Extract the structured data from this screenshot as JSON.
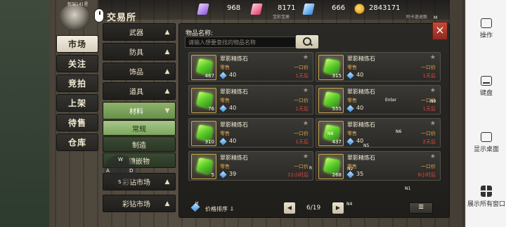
{
  "header": {
    "title": "交易所",
    "level_text": "新瑞141星",
    "close_label": "×"
  },
  "currencies": [
    {
      "icon": "purple-gem-icon",
      "value": "968",
      "color": "#b58af0"
    },
    {
      "icon": "red-gem-icon",
      "value": "8171",
      "color": "#ff5c8a"
    },
    {
      "icon": "blue-gem-icon",
      "value": "666",
      "color": "#5ab4ff"
    },
    {
      "icon": "gold-coin-icon",
      "value": "2843171",
      "color": "#f0b63a"
    }
  ],
  "topbar_sub": {
    "left": "宝前宝册",
    "right": "阿卡迷途致"
  },
  "main_tabs": [
    "市场",
    "关注",
    "竞拍",
    "上架",
    "待售",
    "仓库"
  ],
  "categories": [
    {
      "label": "武器",
      "state": "collapsed"
    },
    {
      "label": "防具",
      "state": "collapsed"
    },
    {
      "label": "饰品",
      "state": "collapsed"
    },
    {
      "label": "道具",
      "state": "collapsed"
    },
    {
      "label": "材料",
      "state": "open"
    }
  ],
  "sub_categories": [
    {
      "label": "常规",
      "active": true
    },
    {
      "label": "制造",
      "active": false
    },
    {
      "label": "镶嵌物",
      "active": false
    }
  ],
  "bottom_categories": [
    "彩钻市场",
    "彩钻市场"
  ],
  "joystick": {
    "up": "W",
    "left": "A",
    "right": "D",
    "down": "S"
  },
  "search": {
    "label": "物品名称:",
    "placeholder": "请输入想要查找的物品名称"
  },
  "items": [
    {
      "name": "翠影精炼石",
      "type": "零售",
      "qty": "467",
      "price": "40",
      "sell": "一口价",
      "time": "1天后"
    },
    {
      "name": "翠影精炼石",
      "type": "零售",
      "qty": "315",
      "price": "40",
      "sell": "一口价",
      "time": "1天后"
    },
    {
      "name": "翠影精炼石",
      "type": "零售",
      "qty": "76",
      "price": "40",
      "sell": "一口价",
      "time": "1天后"
    },
    {
      "name": "翠影精炼石",
      "type": "零售",
      "qty": "555",
      "price": "40",
      "sell": "一口价",
      "time": "1天后"
    },
    {
      "name": "翠影精炼石",
      "type": "零售",
      "qty": "310",
      "price": "40",
      "sell": "一口价",
      "time": "1天后"
    },
    {
      "name": "翠影精炼石",
      "type": "零售",
      "qty": "437",
      "price": "40",
      "sell": "一口价",
      "time": "2天后"
    },
    {
      "name": "翠影精炼石",
      "type": "零售",
      "qty": "5",
      "price": "39",
      "sell": "一口价",
      "time": "11小时后"
    },
    {
      "name": "翠影精炼石",
      "type": "零售",
      "qty": "268",
      "price": "35",
      "sell": "一口价",
      "time": "8小时后"
    }
  ],
  "footer": {
    "sort_label": "价格排序 ⇩",
    "page_text": "6/19",
    "prev": "◀",
    "next": "▶"
  },
  "overlay_keys": [
    "M",
    "Enter",
    "N9",
    "N8",
    "N6",
    "N5",
    "N2",
    "R",
    "N1",
    "N4",
    "H"
  ],
  "emulator_panel": {
    "items": [
      {
        "label": "操作",
        "icon": "operation-icon"
      },
      {
        "label": "键盘",
        "icon": "keyboard-icon"
      },
      {
        "label": "显示桌面",
        "icon": "desktop-icon"
      },
      {
        "label": "展示所有窗口",
        "icon": "windows-grid-icon"
      }
    ]
  }
}
